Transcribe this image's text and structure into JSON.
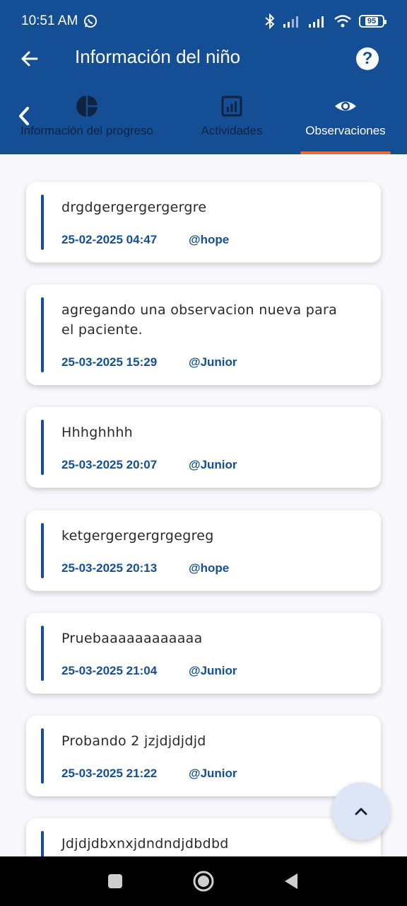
{
  "status_bar": {
    "time": "10:51 AM",
    "battery": "95"
  },
  "appbar": {
    "title": "Información del niño",
    "help": "?"
  },
  "tabs": [
    {
      "label": "Información del progreso",
      "icon": "pie-chart-icon"
    },
    {
      "label": "Actividades",
      "icon": "bar-chart-icon"
    },
    {
      "label": "Observaciones",
      "icon": "eye-icon"
    }
  ],
  "observations": [
    {
      "text": "drgdgergergergergre",
      "date": "25-02-2025 04:47",
      "user": "@hope"
    },
    {
      "text": "agregando una observacion nueva para el paciente.",
      "date": "25-03-2025 15:29",
      "user": "@Junior"
    },
    {
      "text": "Hhhghhhh",
      "date": "25-03-2025 20:07",
      "user": "@Junior"
    },
    {
      "text": "ketgergergergrgegreg",
      "date": "25-03-2025 20:13",
      "user": "@hope"
    },
    {
      "text": "Pruebaaaaaaaaaaaa",
      "date": "25-03-2025 21:04",
      "user": "@Junior"
    },
    {
      "text": "Probando 2 jzjdjdjdjd",
      "date": "25-03-2025 21:22",
      "user": "@Junior"
    },
    {
      "text": "Jdjdjdbxnxjdndndjdbdbd",
      "date": "",
      "user": ""
    }
  ],
  "colors": {
    "primary": "#144f96",
    "accent": "#e86c3a"
  }
}
